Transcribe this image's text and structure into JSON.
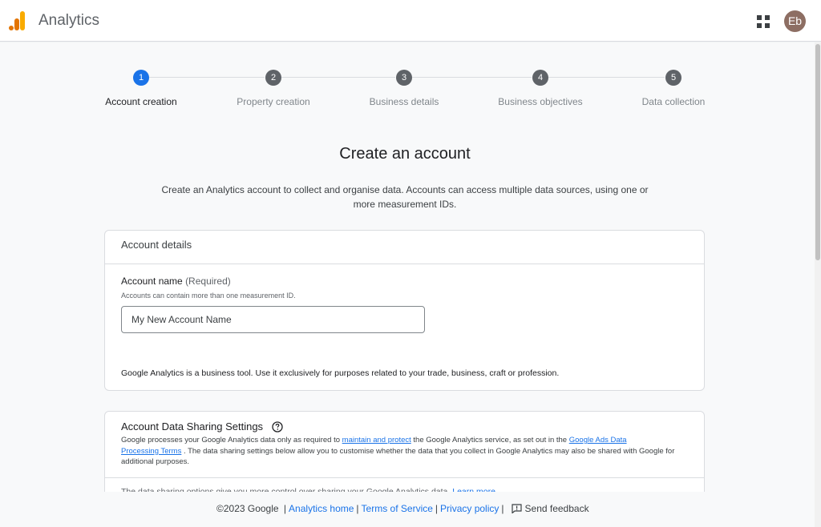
{
  "header": {
    "app_title": "Analytics",
    "avatar_initials": "Eb",
    "apps_icon": "apps-grid-icon",
    "brand_colors": [
      "#f9ab00",
      "#e37400"
    ]
  },
  "stepper": {
    "steps": [
      {
        "number": "1",
        "label": "Account creation",
        "active": true
      },
      {
        "number": "2",
        "label": "Property creation",
        "active": false
      },
      {
        "number": "3",
        "label": "Business details",
        "active": false
      },
      {
        "number": "4",
        "label": "Business objectives",
        "active": false
      },
      {
        "number": "5",
        "label": "Data collection",
        "active": false
      }
    ],
    "active_color": "#1a73e8",
    "inactive_color": "#5f6368"
  },
  "page": {
    "title": "Create an account",
    "description_line1": "Create an Analytics account to collect and organise data. Accounts can access multiple data sources, using one or",
    "description_line2": "more measurement IDs."
  },
  "account_details": {
    "header": "Account details",
    "field_label": "Account name",
    "field_required": "(Required)",
    "field_hint": "Accounts can contain more than one measurement ID.",
    "input_placeholder": "My New Account Name",
    "input_value": "",
    "business_note": "Google Analytics is a business tool. Use it exclusively for purposes related to your trade, business, craft or profession."
  },
  "data_sharing": {
    "title": "Account Data Sharing Settings",
    "help_icon": "help-circle-icon",
    "desc_part1": "Google processes your Google Analytics data only as required to ",
    "link_maintain": "maintain and protect",
    "desc_part2": " the Google Analytics service, as set out in the ",
    "link_terms_line1": "Google Ads Data",
    "link_terms_line2": "Processing Terms",
    "desc_part3": " . The data sharing settings below allow you to customise whether the data that you collect in Google Analytics may also be shared with Google for additional purposes.",
    "options_text": "The data sharing options give you more control over sharing your Google Analytics data.",
    "learn_more": "Learn more"
  },
  "footer": {
    "copyright": "©2023 Google",
    "sep": "|",
    "analytics_home": "Analytics home",
    "terms": "Terms of Service",
    "privacy": "Privacy policy",
    "feedback": "Send feedback",
    "feedback_icon": "feedback-icon"
  }
}
